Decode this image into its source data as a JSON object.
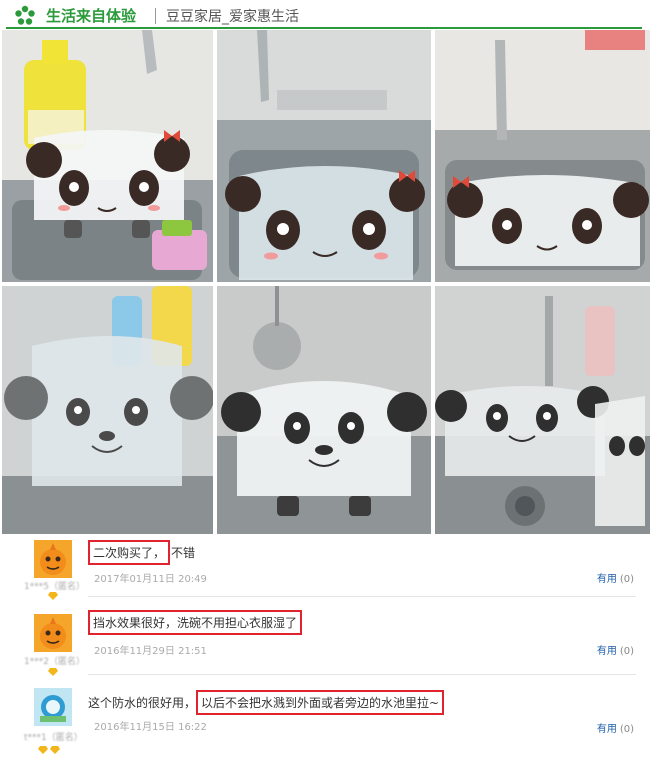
{
  "header": {
    "title": "生活来自体验",
    "subtitle": "豆豆家居_爱家惠生活",
    "accent_color": "#2a9a3a",
    "logo_icon": "flower-icon"
  },
  "gallery": {
    "photos": [
      {
        "name": "photo-panda-board-sink-1"
      },
      {
        "name": "photo-panda-board-sink-2"
      },
      {
        "name": "photo-panda-board-sink-3"
      },
      {
        "name": "photo-panda-board-sink-4"
      },
      {
        "name": "photo-panda-board-sink-5"
      },
      {
        "name": "photo-panda-board-sink-6"
      }
    ]
  },
  "reviews": [
    {
      "highlight": "二次购买了，",
      "text_before": "",
      "text_after": "不错",
      "date": "2017年01月11日 20:49",
      "helpful_label": "有用",
      "helpful_count": "(0)",
      "avatar_icon": "orange-character-avatar"
    },
    {
      "highlight": "挡水效果很好，洗碗不用担心衣服湿了",
      "text_before": "",
      "text_after": "",
      "date": "2016年11月29日 21:51",
      "helpful_label": "有用",
      "helpful_count": "(0)",
      "avatar_icon": "orange-character-avatar"
    },
    {
      "highlight": "以后不会把水溅到外面或者旁边的水池里拉~",
      "text_before": "这个防水的很好用，",
      "text_after": "",
      "date": "2016年11月15日 16:22",
      "helpful_label": "有用",
      "helpful_count": "(0)",
      "avatar_icon": "cartoon-picture-avatar"
    }
  ],
  "colors": {
    "highlight_border": "#e0232e",
    "helpful_link": "#1f5fa8",
    "rank_diamond": "#f2b51c"
  }
}
